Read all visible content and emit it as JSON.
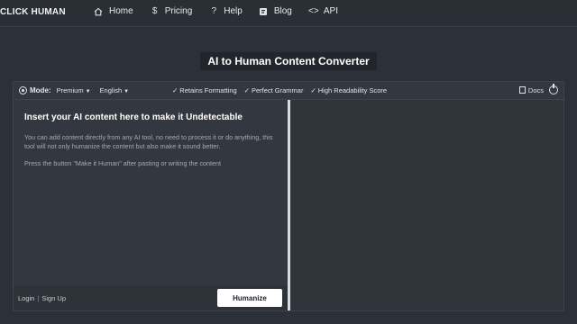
{
  "brand": "CLICK HUMAN",
  "nav": [
    {
      "label": "Home",
      "icon": "home-icon"
    },
    {
      "label": "Pricing",
      "icon": "dollar-icon"
    },
    {
      "label": "Help",
      "icon": "question-icon"
    },
    {
      "label": "Blog",
      "icon": "blog-icon"
    },
    {
      "label": "API",
      "icon": "code-icon"
    }
  ],
  "title": "AI to Human Content Converter",
  "toolbar": {
    "mode_label": "Mode:",
    "mode_value": "Premium",
    "language_value": "English",
    "features": [
      "Retains Formatting",
      "Perfect Grammar",
      "High Readability Score"
    ],
    "docs_label": "Docs"
  },
  "editor": {
    "heading": "Insert your AI content here to make it Undetectable",
    "paragraph1": "You can add content directly from any AI tool, no need to process it or do anything, this tool will not only humanize the content but also make it sound better.",
    "paragraph2": "Press the button \"Make it Human\" after pasting or writing the content"
  },
  "footer": {
    "login": "Login",
    "separator": "|",
    "signup": "Sign Up",
    "humanize_button": "Humanize"
  }
}
